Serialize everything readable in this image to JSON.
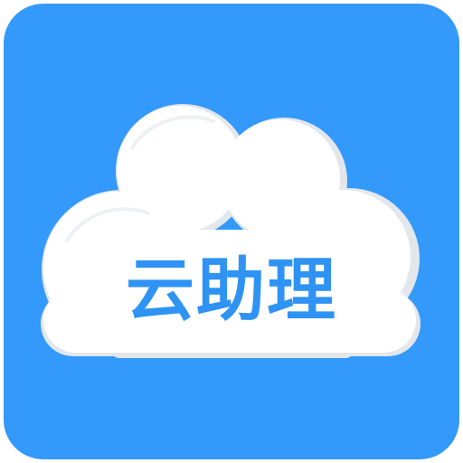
{
  "app": {
    "name": "云助理"
  },
  "colors": {
    "background": "#3399fb",
    "cloud": "#ffffff",
    "cloud_shadow": "#e7eaee",
    "text": "#2e93f3"
  },
  "icons": {
    "cloud": "cloud-icon"
  }
}
